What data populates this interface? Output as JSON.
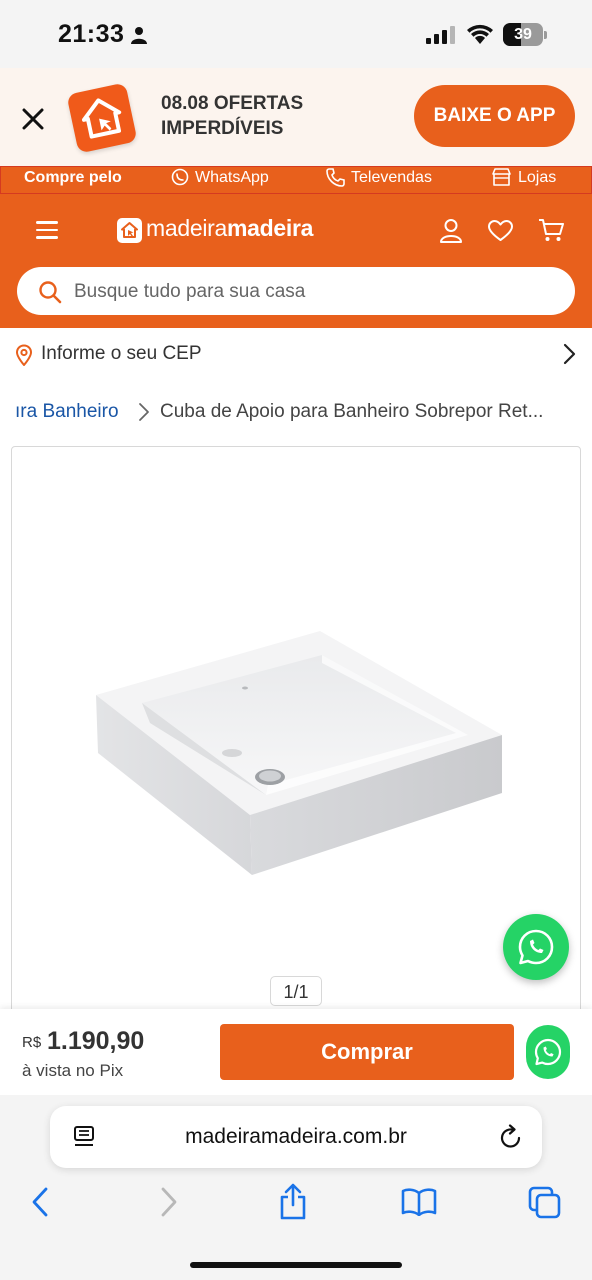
{
  "status_bar": {
    "time": "21:33",
    "battery": "39"
  },
  "promo": {
    "title": "08.08 OFERTAS IMPERDÍVEIS",
    "cta": "BAIXE O APP",
    "accent_color": "#e8601c"
  },
  "contact_strip": {
    "label": "Compre pelo",
    "items": [
      "WhatsApp",
      "Televendas",
      "Lojas"
    ]
  },
  "header": {
    "brand_light": "madeira",
    "brand_bold": "madeira",
    "icons": [
      "menu-icon",
      "user-icon",
      "heart-icon",
      "cart-icon"
    ]
  },
  "search": {
    "placeholder": "Busque tudo para sua casa"
  },
  "cep": {
    "label": "Informe o seu CEP"
  },
  "breadcrumb": {
    "parent": "ıra Banheiro",
    "current": "Cuba de Apoio para Banheiro Sobrepor Ret..."
  },
  "gallery": {
    "counter": "1/1"
  },
  "buy_bar": {
    "currency": "R$",
    "price": "1.190,90",
    "price_note": "à vista no Pix",
    "buy_label": "Comprar"
  },
  "browser": {
    "url": "madeiramadeira.com.br"
  }
}
